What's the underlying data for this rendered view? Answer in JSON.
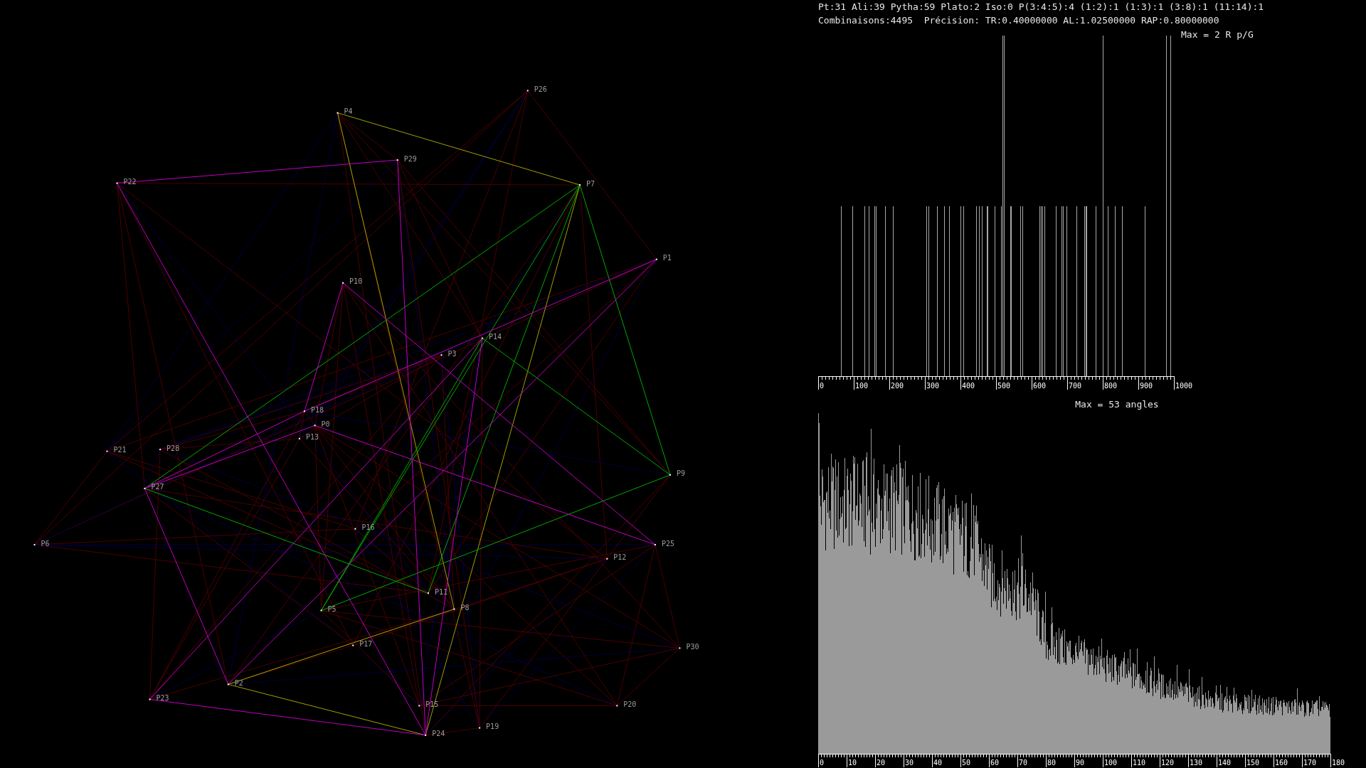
{
  "header": {
    "stats": "Pt:31 Ali:39 Pytha:59 Plato:2 Iso:0 P(3:4:5):4 (1:2):1 (1:3):1 (3:8):1 (11:14):1",
    "settings": "Combinaisons:4495  Précision: TR:0.40000000 AL:1.02500000 RAP:0.80000000"
  },
  "graph": {
    "points": [
      {
        "label": "P0"
      },
      {
        "label": "P1"
      },
      {
        "label": "P2"
      },
      {
        "label": "P3"
      },
      {
        "label": "P4"
      },
      {
        "label": "P5"
      },
      {
        "label": "P6"
      },
      {
        "label": "P7"
      },
      {
        "label": "P8"
      },
      {
        "label": "P9"
      },
      {
        "label": "P10"
      },
      {
        "label": "P11"
      },
      {
        "label": "P12"
      },
      {
        "label": "P13"
      },
      {
        "label": "P14"
      },
      {
        "label": "P15"
      },
      {
        "label": "P16"
      },
      {
        "label": "P17"
      },
      {
        "label": "P18"
      },
      {
        "label": "P19"
      },
      {
        "label": "P20"
      },
      {
        "label": "P21"
      },
      {
        "label": "P22"
      },
      {
        "label": "P23"
      },
      {
        "label": "P24"
      },
      {
        "label": "P25"
      },
      {
        "label": "P26"
      },
      {
        "label": "P27"
      },
      {
        "label": "P28"
      },
      {
        "label": "P29"
      },
      {
        "label": "P30"
      }
    ]
  },
  "ratio_histogram": {
    "title": "Max = 2 R p/G",
    "tick_labels": [
      "0",
      "100",
      "200",
      "300",
      "400",
      "500",
      "600",
      "700",
      "800",
      "900",
      "1000"
    ]
  },
  "angle_histogram": {
    "title": "Max = 53 angles",
    "tick_labels": [
      "0",
      "10",
      "20",
      "30",
      "40",
      "50",
      "60",
      "70",
      "80",
      "90",
      "100",
      "110",
      "120",
      "130",
      "140",
      "150",
      "160",
      "170",
      "180"
    ]
  }
}
